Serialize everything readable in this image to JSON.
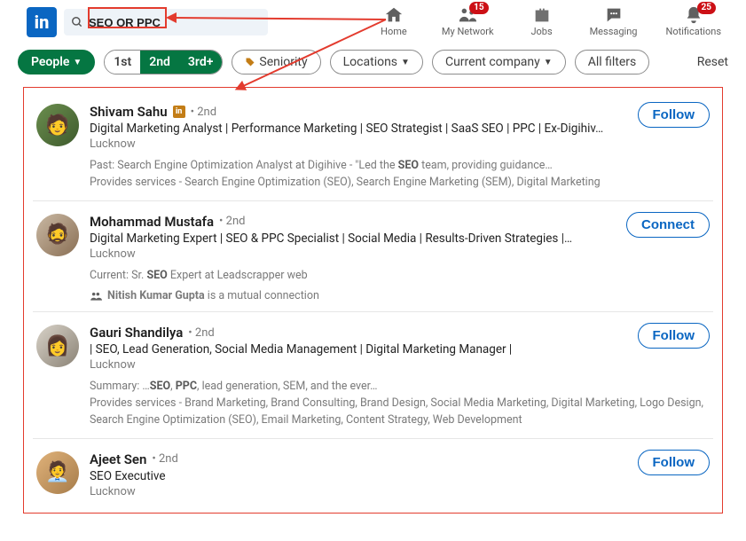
{
  "search": {
    "value": "SEO OR PPC"
  },
  "nav": {
    "home": "Home",
    "network": "My Network",
    "jobs": "Jobs",
    "messaging": "Messaging",
    "notifications": "Notifications",
    "badge_network": "15",
    "badge_notifications": "25"
  },
  "filters": {
    "people": "People",
    "seg1": "1st",
    "seg2": "2nd",
    "seg3": "3rd+",
    "seniority": "Seniority",
    "locations": "Locations",
    "company": "Current company",
    "all": "All filters",
    "reset": "Reset"
  },
  "results": [
    {
      "name": "Shivam Sahu",
      "degree": "• 2nd",
      "premium": true,
      "headline": "Digital Marketing Analyst | Performance Marketing | SEO Strategist | SaaS SEO | PPC | Ex-Digihiv…",
      "location": "Lucknow",
      "past_prefix": "Past: Search Engine Optimization Analyst at Digihive - \"Led the ",
      "past_bold": "SEO",
      "past_suffix": " team, providing guidance…",
      "services": "Provides services - Search Engine Optimization (SEO), Search Engine Marketing (SEM), Digital Marketing",
      "action": "Follow"
    },
    {
      "name": "Mohammad Mustafa",
      "degree": "• 2nd",
      "premium": false,
      "headline": "Digital Marketing Expert | SEO & PPC Specialist | Social Media | Results-Driven Strategies |…",
      "location": "Lucknow",
      "current_prefix": "Current: Sr. ",
      "current_bold": "SEO",
      "current_suffix": " Expert at Leadscrapper web",
      "mutual_bold": "Nitish Kumar Gupta",
      "mutual_rest": " is a mutual connection",
      "action": "Connect"
    },
    {
      "name": "Gauri Shandilya",
      "degree": "• 2nd",
      "premium": false,
      "headline": "| SEO, Lead Generation, Social Media Management | Digital Marketing Manager |",
      "location": "Lucknow",
      "summary_prefix": "Summary: …",
      "summary_bold1": "SEO",
      "summary_mid": ", ",
      "summary_bold2": "PPC",
      "summary_suffix": ", lead generation, SEM, and the ever…",
      "services": "Provides services - Brand Marketing, Brand Consulting, Brand Design, Social Media Marketing, Digital Marketing, Logo Design, Search Engine Optimization (SEO), Email Marketing, Content Strategy, Web Development",
      "action": "Follow"
    },
    {
      "name": "Ajeet Sen",
      "degree": "• 2nd",
      "premium": false,
      "headline": "SEO Executive",
      "location": "Lucknow",
      "action": "Follow"
    }
  ],
  "colors": {
    "accent": "#0A66C2",
    "green": "#057642",
    "annotation": "#E33B2E"
  }
}
